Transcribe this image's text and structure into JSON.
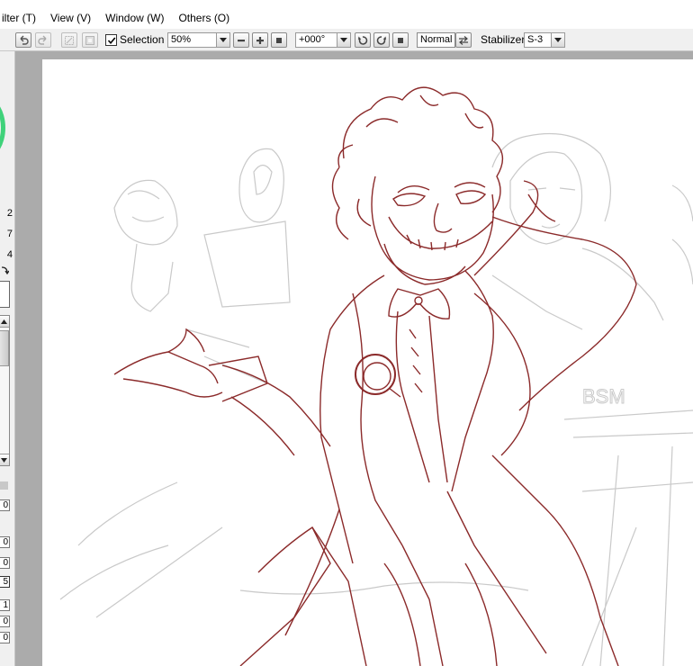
{
  "menu": {
    "items": [
      "ilter (T)",
      "View (V)",
      "Window (W)",
      "Others (O)"
    ]
  },
  "toolbar": {
    "selection_label": "Selection",
    "selection_checked": true,
    "zoom_value": "50%",
    "rotation_value": "+000°",
    "blend_mode": "Normal",
    "stabilizer_label": "Stabilizer",
    "stabilizer_value": "S-3"
  },
  "left_panel": {
    "values": [
      "2",
      "7",
      "4"
    ],
    "fields": [
      "0",
      "0",
      "0",
      "5",
      "1",
      "0",
      "0"
    ]
  },
  "canvas": {
    "line_color_main": "#8b2a2a",
    "line_color_sketch": "#c9c9c9",
    "sketch_text": "BSM"
  },
  "colors": {
    "accent_ring": "#3fd27a",
    "canvas_bg": "#ababab",
    "toolbar_bg": "#f0f0f0"
  }
}
